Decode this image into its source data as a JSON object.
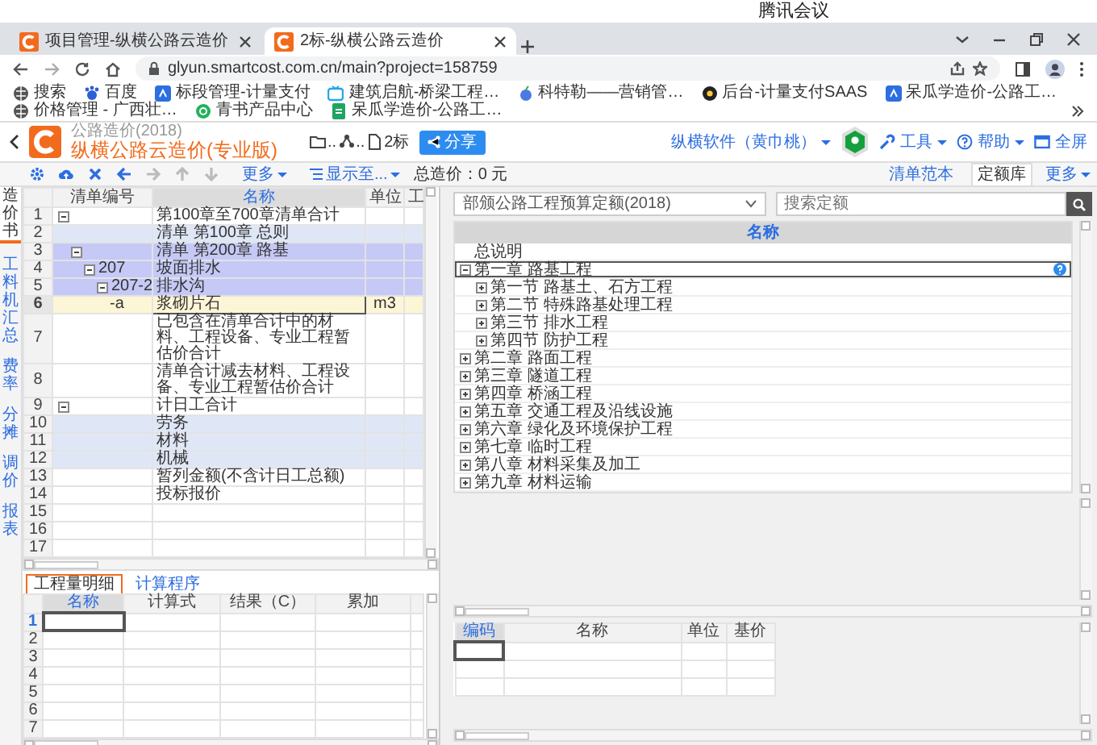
{
  "meeting_app": {
    "title": "腾讯会议"
  },
  "browser": {
    "tabs": [
      {
        "title": "项目管理-纵横公路云造价",
        "selected": false
      },
      {
        "title": "2标-纵横公路云造价",
        "selected": true
      }
    ],
    "url": "glyun.smartcost.com.cn/main?project=158759",
    "bookmarks": [
      {
        "label": "搜索",
        "kind": "globe"
      },
      {
        "label": "百度",
        "kind": "paw"
      },
      {
        "label": "标段管理-计量支付",
        "kind": "app"
      },
      {
        "label": "建筑启航-桥梁工程…",
        "kind": "tv"
      },
      {
        "label": "科特勒——营销管…",
        "kind": "fruit"
      },
      {
        "label": "后台-计量支付SAAS",
        "kind": "dark"
      },
      {
        "label": "呆瓜学造价-公路工…",
        "kind": "app"
      },
      {
        "label": "价格管理 - 广西壮…",
        "kind": "globe"
      },
      {
        "label": "青书产品中心",
        "kind": "chat"
      },
      {
        "label": "呆瓜学造价-公路工…",
        "kind": "sheet"
      }
    ]
  },
  "app": {
    "subtitle": "公路造价(2018)",
    "title": "纵横公路云造价(专业版)",
    "breadcrumb": [
      "..",
      "..",
      "2标"
    ],
    "share": "分享",
    "account": "纵横软件（黄巾桃）",
    "menus": [
      {
        "label": "工具",
        "kind": "tools"
      },
      {
        "label": "帮助",
        "kind": "help"
      },
      {
        "label": "全屏",
        "kind": "fullscreen"
      }
    ]
  },
  "toolbar": {
    "buttons": [
      {
        "kind": "settings",
        "disabled": false
      },
      {
        "kind": "upload",
        "disabled": false
      },
      {
        "kind": "delete",
        "disabled": false
      },
      {
        "kind": "left",
        "disabled": false
      },
      {
        "kind": "right",
        "disabled": true
      },
      {
        "kind": "up",
        "disabled": true
      },
      {
        "kind": "down",
        "disabled": true
      }
    ],
    "more": "更多",
    "display": "显示至...",
    "total": "总造价：0 元",
    "panel_tabs": [
      {
        "label": "清单范本",
        "selected": false
      },
      {
        "label": "定额库",
        "selected": true
      }
    ],
    "panel_more": "更多"
  },
  "side_nav": [
    {
      "label": "造价书",
      "selected": true
    },
    {
      "label": "工料机汇总",
      "selected": false
    },
    {
      "label": "费率",
      "selected": false
    },
    {
      "label": "分摊",
      "selected": false
    },
    {
      "label": "调价",
      "selected": false
    },
    {
      "label": "报表",
      "selected": false
    }
  ],
  "bill_table": {
    "columns": [
      {
        "label": "清单编号",
        "selected": false
      },
      {
        "label": "名称",
        "selected": true
      },
      {
        "label": "单位",
        "selected": false
      },
      {
        "label": "工",
        "selected": false
      }
    ],
    "rows": [
      {
        "no": "1",
        "name": "第100章至700章清单合计",
        "highlighted": false,
        "selected": false,
        "current": false,
        "expanded": true,
        "children": [
          {
            "no": "2",
            "name": "清单 第100章 总则",
            "highlighted": true,
            "selected": false,
            "current": false
          },
          {
            "no": "3",
            "name": "清单 第200章 路基",
            "highlighted": false,
            "selected": true,
            "current": false,
            "expanded": true,
            "children": [
              {
                "no": "4",
                "code": "207",
                "name": "坡面排水",
                "highlighted": false,
                "selected": true,
                "current": false,
                "expanded": true,
                "children": [
                  {
                    "no": "5",
                    "code": "207-2",
                    "name": "排水沟",
                    "highlighted": false,
                    "selected": true,
                    "current": false,
                    "expanded": true,
                    "children": [
                      {
                        "no": "6",
                        "code": "-a",
                        "name": "浆砌片石",
                        "unit": "m3",
                        "highlighted": false,
                        "selected": false,
                        "current": true
                      }
                    ]
                  }
                ]
              }
            ]
          },
          {
            "no": "7",
            "name": "已包含在清单合计中的材料、工程设备、专业工程暂估价合计",
            "highlighted": false,
            "selected": false,
            "current": false
          },
          {
            "no": "8",
            "name": "清单合计减去材料、工程设备、专业工程暂估价合计",
            "highlighted": false,
            "selected": false,
            "current": false
          }
        ]
      },
      {
        "no": "9",
        "name": "计日工合计",
        "highlighted": false,
        "selected": false,
        "current": false,
        "expanded": true,
        "children": [
          {
            "no": "10",
            "name": "劳务",
            "highlighted": true,
            "selected": false,
            "current": false
          },
          {
            "no": "11",
            "name": "材料",
            "highlighted": true,
            "selected": false,
            "current": false
          },
          {
            "no": "12",
            "name": "机械",
            "highlighted": true,
            "selected": false,
            "current": false
          }
        ]
      },
      {
        "no": "13",
        "name": "暂列金额(不含计日工总额)",
        "highlighted": false,
        "selected": false,
        "current": false
      },
      {
        "no": "14",
        "name": "投标报价",
        "highlighted": false,
        "selected": false,
        "current": false
      },
      {
        "no": "15",
        "highlighted": false,
        "selected": false,
        "current": false
      },
      {
        "no": "16",
        "highlighted": false,
        "selected": false,
        "current": false
      },
      {
        "no": "17",
        "highlighted": false,
        "selected": false,
        "current": false
      }
    ]
  },
  "detail": {
    "tabs": [
      {
        "label": "工程量明细",
        "selected": true
      },
      {
        "label": "计算程序",
        "selected": false
      }
    ],
    "columns": [
      {
        "label": "名称",
        "selected": true
      },
      {
        "label": "计算式",
        "selected": false
      },
      {
        "label": "结果（C）",
        "selected": false
      },
      {
        "label": "累加",
        "selected": false
      }
    ],
    "rows": [
      {
        "no": "1",
        "selected": true
      },
      {
        "no": "2",
        "selected": false
      },
      {
        "no": "3",
        "selected": false
      },
      {
        "no": "4",
        "selected": false
      },
      {
        "no": "5",
        "selected": false
      },
      {
        "no": "6",
        "selected": false
      },
      {
        "no": "7",
        "selected": false
      }
    ]
  },
  "quota": {
    "library": "部颁公路工程预算定额(2018)",
    "search": {
      "placeholder": "搜索定额"
    },
    "column": "名称",
    "tree": [
      {
        "label": "总说明",
        "selected": false
      },
      {
        "label": "第一章 路基工程",
        "selected": true,
        "expanded": true,
        "children": [
          {
            "label": "第一节 路基土、石方工程",
            "selected": false,
            "expanded": false
          },
          {
            "label": "第二节 特殊路基处理工程",
            "selected": false,
            "expanded": false
          },
          {
            "label": "第三节 排水工程",
            "selected": false,
            "expanded": false
          },
          {
            "label": "第四节 防护工程",
            "selected": false,
            "expanded": false
          }
        ]
      },
      {
        "label": "第二章 路面工程",
        "selected": false,
        "expanded": false
      },
      {
        "label": "第三章 隧道工程",
        "selected": false,
        "expanded": false
      },
      {
        "label": "第四章 桥涵工程",
        "selected": false,
        "expanded": false
      },
      {
        "label": "第五章 交通工程及沿线设施",
        "selected": false,
        "expanded": false
      },
      {
        "label": "第六章 绿化及环境保护工程",
        "selected": false,
        "expanded": false
      },
      {
        "label": "第七章 临时工程",
        "selected": false,
        "expanded": false
      },
      {
        "label": "第八章 材料采集及加工",
        "selected": false,
        "expanded": false
      },
      {
        "label": "第九章 材料运输",
        "selected": false,
        "expanded": false
      }
    ],
    "resources": {
      "columns": [
        {
          "label": "编码",
          "selected": true
        },
        {
          "label": "名称",
          "selected": false
        },
        {
          "label": "单位",
          "selected": false
        },
        {
          "label": "基价",
          "selected": false
        }
      ],
      "rows": [
        {
          "selected": true
        },
        {
          "selected": false
        },
        {
          "selected": false
        }
      ]
    }
  }
}
